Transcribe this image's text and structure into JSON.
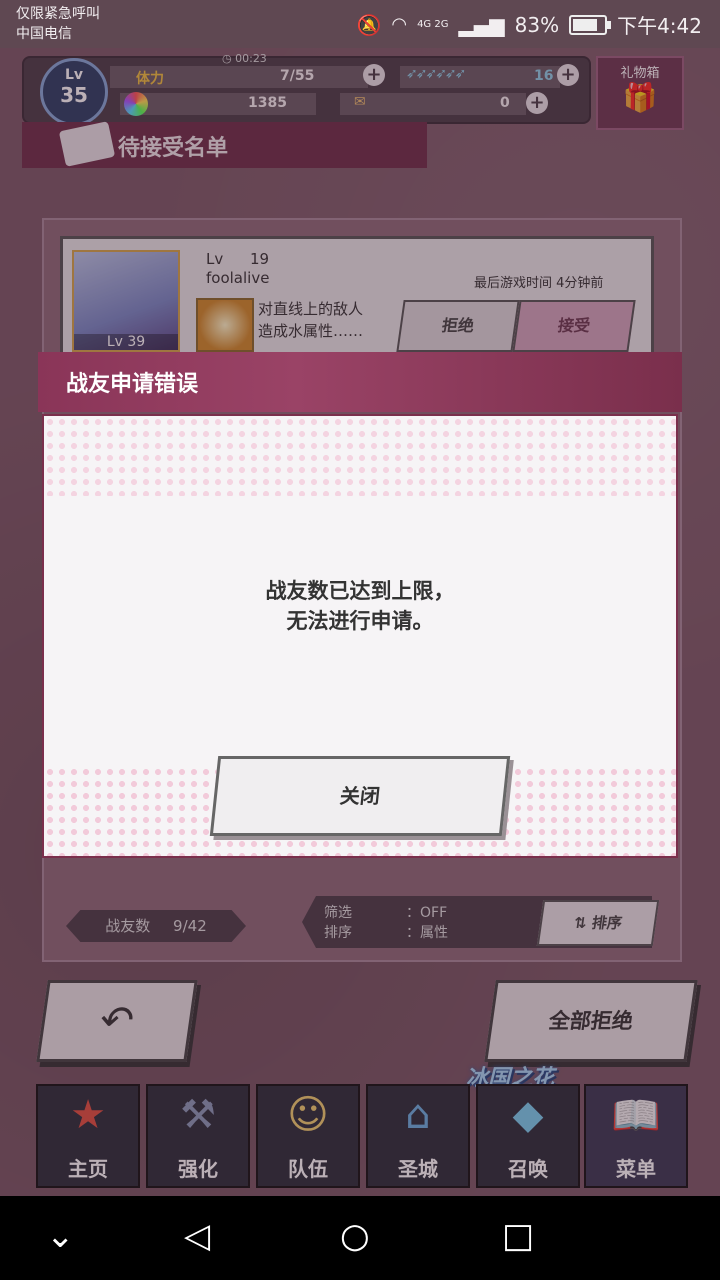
{
  "status_bar": {
    "line1": "仅限紧急呼叫",
    "line2": "中国电信",
    "battery": "83%",
    "time": "下午4:42",
    "network": "4G 2G"
  },
  "header": {
    "level_label": "Lv",
    "level": "35",
    "stamina_label": "体力",
    "timer": "00:23",
    "stamina": "7/55",
    "feathers": "16",
    "gems": "1385",
    "tickets": "0",
    "gift_box": "礼物箱"
  },
  "section": {
    "title": "待接受名单"
  },
  "friend": {
    "lv_label": "Lv",
    "lv": "19",
    "name": "foolalive",
    "last_played": "最后游戏时间 4分钟前",
    "avatar_lv": "Lv 39",
    "skill_line1": "对直线上的敌人",
    "skill_line2": "造成水属性……",
    "reject": "拒绝",
    "accept": "接受"
  },
  "dialog": {
    "title": "战友申请错误",
    "line1": "战友数已达到上限，",
    "line2": "无法进行申请。",
    "close": "关闭"
  },
  "footer_info": {
    "count_label": "战友数",
    "count_value": "9/42",
    "filter_label": "筛选",
    "filter_value": "：OFF",
    "sort_label": "排序",
    "sort_value": "：属性",
    "sort_button": "排序",
    "sort_icon": "sort-icon"
  },
  "actions": {
    "back_icon": "back-arrow-icon",
    "reject_all": "全部拒绝"
  },
  "banner": "冰国之花",
  "nav": [
    {
      "label": "主页",
      "icon": "home-icon"
    },
    {
      "label": "强化",
      "icon": "hammer-icon"
    },
    {
      "label": "队伍",
      "icon": "team-icon"
    },
    {
      "label": "圣城",
      "icon": "castle-icon"
    },
    {
      "label": "召唤",
      "icon": "crystal-icon"
    },
    {
      "label": "菜单",
      "icon": "book-icon"
    }
  ],
  "colors": {
    "accent": "#8a3558",
    "panel": "#4b3e48",
    "background": "#7c5a67"
  }
}
